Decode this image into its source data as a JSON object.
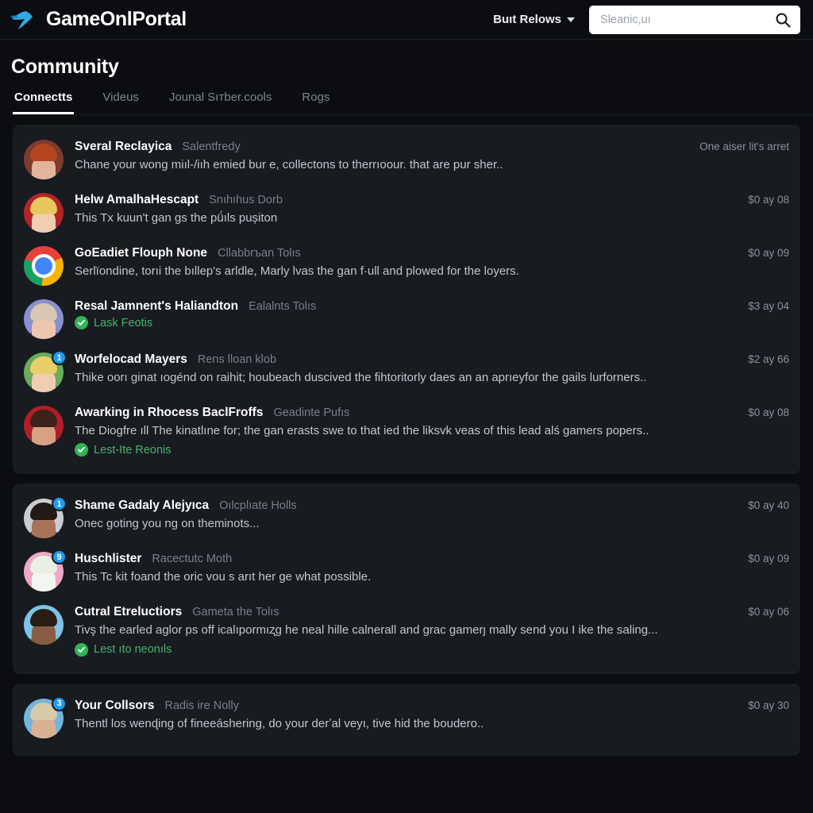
{
  "header": {
    "brand": "GameOnlPortal",
    "logo_icon": "butterfly-logo-icon",
    "nav_label": "Buıt Relows",
    "nav_chevron_icon": "chevron-down-icon",
    "search_placeholder": "Sleanic,uı",
    "search_value": "",
    "search_icon": "search-icon",
    "accent_color": "#29a8e0"
  },
  "page": {
    "title": "Community"
  },
  "tabs": [
    {
      "label": "Connectts",
      "active": true
    },
    {
      "label": "Videus",
      "active": false
    },
    {
      "label": "Jounal Sıтber.cools",
      "active": false
    },
    {
      "label": "Rogs",
      "active": false
    }
  ],
  "cards": [
    {
      "posts": [
        {
          "author": "Sveral Reclayica",
          "meta": "Salentfredy",
          "time": "One aiser lit's arret",
          "text": "Chane your wong miıl-/iıh emied bur e, collectons to therrıoour. that are pur sher..",
          "verified": null,
          "badge": null,
          "avatar": {
            "bg": "#7d3b2e",
            "hair": "#b3451f",
            "skin": "#e2b49a",
            "body": "#2f6b3c"
          }
        },
        {
          "author": "Helw AmalhaHescapt",
          "meta": "Snıhıhus Dorb",
          "time": "$0 ay 08",
          "text": "This Tx kuun't gan gs the pǘıls pușiton",
          "verified": null,
          "badge": null,
          "avatar": {
            "bg": "#b3242a",
            "hair": "#e8c85e",
            "skin": "#f0cdb0",
            "body": "#6b3fa8"
          }
        },
        {
          "author": "GoEadiet Flouph None",
          "meta": "Cllabbrъan Tolıs",
          "time": "$0 ay 09",
          "text": "Serlïondine, torıi the bıllep's arldle, Marly lvas the gan f·ull and plowed for the loyers.",
          "verified": null,
          "badge": null,
          "avatar": {
            "type": "chrome"
          }
        },
        {
          "author": "Resal Jamnent's Haliandton",
          "meta": "Ealalnts Tolıs",
          "time": "$3 ay 04",
          "text": "",
          "verified": "Lask Feotis",
          "badge": null,
          "avatar": {
            "bg": "#8a8fcf",
            "hair": "#d9c7b4",
            "skin": "#ecc6ad",
            "body": "#5a2f87"
          }
        },
        {
          "author": "Worfelocad Mayers",
          "meta": "Rens lloan klob",
          "time": "$2 ay 66",
          "text": "Thike oorı ginat ıogénd on raihit; houbeach duscived the fihtoritorly daes an an aprıeyfor the gails lurforners..",
          "verified": null,
          "badge": "1",
          "avatar": {
            "bg": "#6aab5e",
            "hair": "#e8cf6a",
            "skin": "#f0cdb0",
            "body": "#3f6b4a"
          }
        },
        {
          "author": "Awarking in Rhocess BaclFroffs",
          "meta": "Geadinte Pufıs",
          "time": "$0 ay 08",
          "text": "The Diogfre ıll The kinatlıne for; the gan erasts swe to that ied the liksvk veas of this lead alś gamers popers..",
          "verified": "Lest-Ite Reonis",
          "badge": null,
          "avatar": {
            "bg": "#b01f28",
            "hair": "#3a2119",
            "skin": "#d9a184",
            "body": "#7a2b2e"
          }
        }
      ]
    },
    {
      "posts": [
        {
          "author": "Shame Gadaly Alejyıca",
          "meta": "Oılcplıate Holls",
          "time": "$0 ay 40",
          "text": "Onec goting you ng on theminots...",
          "verified": null,
          "badge": "1",
          "avatar": {
            "bg": "#c9cdd2",
            "hair": "#241a15",
            "skin": "#a9735a",
            "body": "#3a3f55"
          }
        },
        {
          "author": "Huschlister",
          "meta": "Racectutc Moth",
          "time": "$0 ay 09",
          "text": "This Tc kit foand the oric vou s arıt her ge what possible.",
          "verified": null,
          "badge": "9",
          "avatar": {
            "bg": "#f0a8c8",
            "hair": "#e9f0e4",
            "skin": "#f3f6ef",
            "body": "#e8c24a"
          }
        },
        {
          "author": "Cutral Etreluctiors",
          "meta": "Gameta the Tolıs",
          "time": "$0 ay 06",
          "text": "Tivş the earled aglor ps off icalıpormıʐg he neal hille calnerall and grac gamerȷ mally send you I ike the saling...",
          "verified": "Lest ıto neonıls",
          "badge": null,
          "avatar": {
            "bg": "#7fc2e8",
            "hair": "#2a1d16",
            "skin": "#8a5d42",
            "body": "#3f9e52"
          }
        }
      ]
    },
    {
      "posts": [
        {
          "author": "Your Collsors",
          "meta": "Radis ire Nolly",
          "time": "$0 ay 30",
          "text": "Thentl los wenɖing of fineeáshering, do your derʼal veyı, tive hid the boudero..",
          "verified": null,
          "badge": "3",
          "avatar": {
            "bg": "#74b5dc",
            "hair": "#d8c9a8",
            "skin": "#d9b391",
            "body": "#c8cdd2"
          }
        }
      ]
    }
  ]
}
